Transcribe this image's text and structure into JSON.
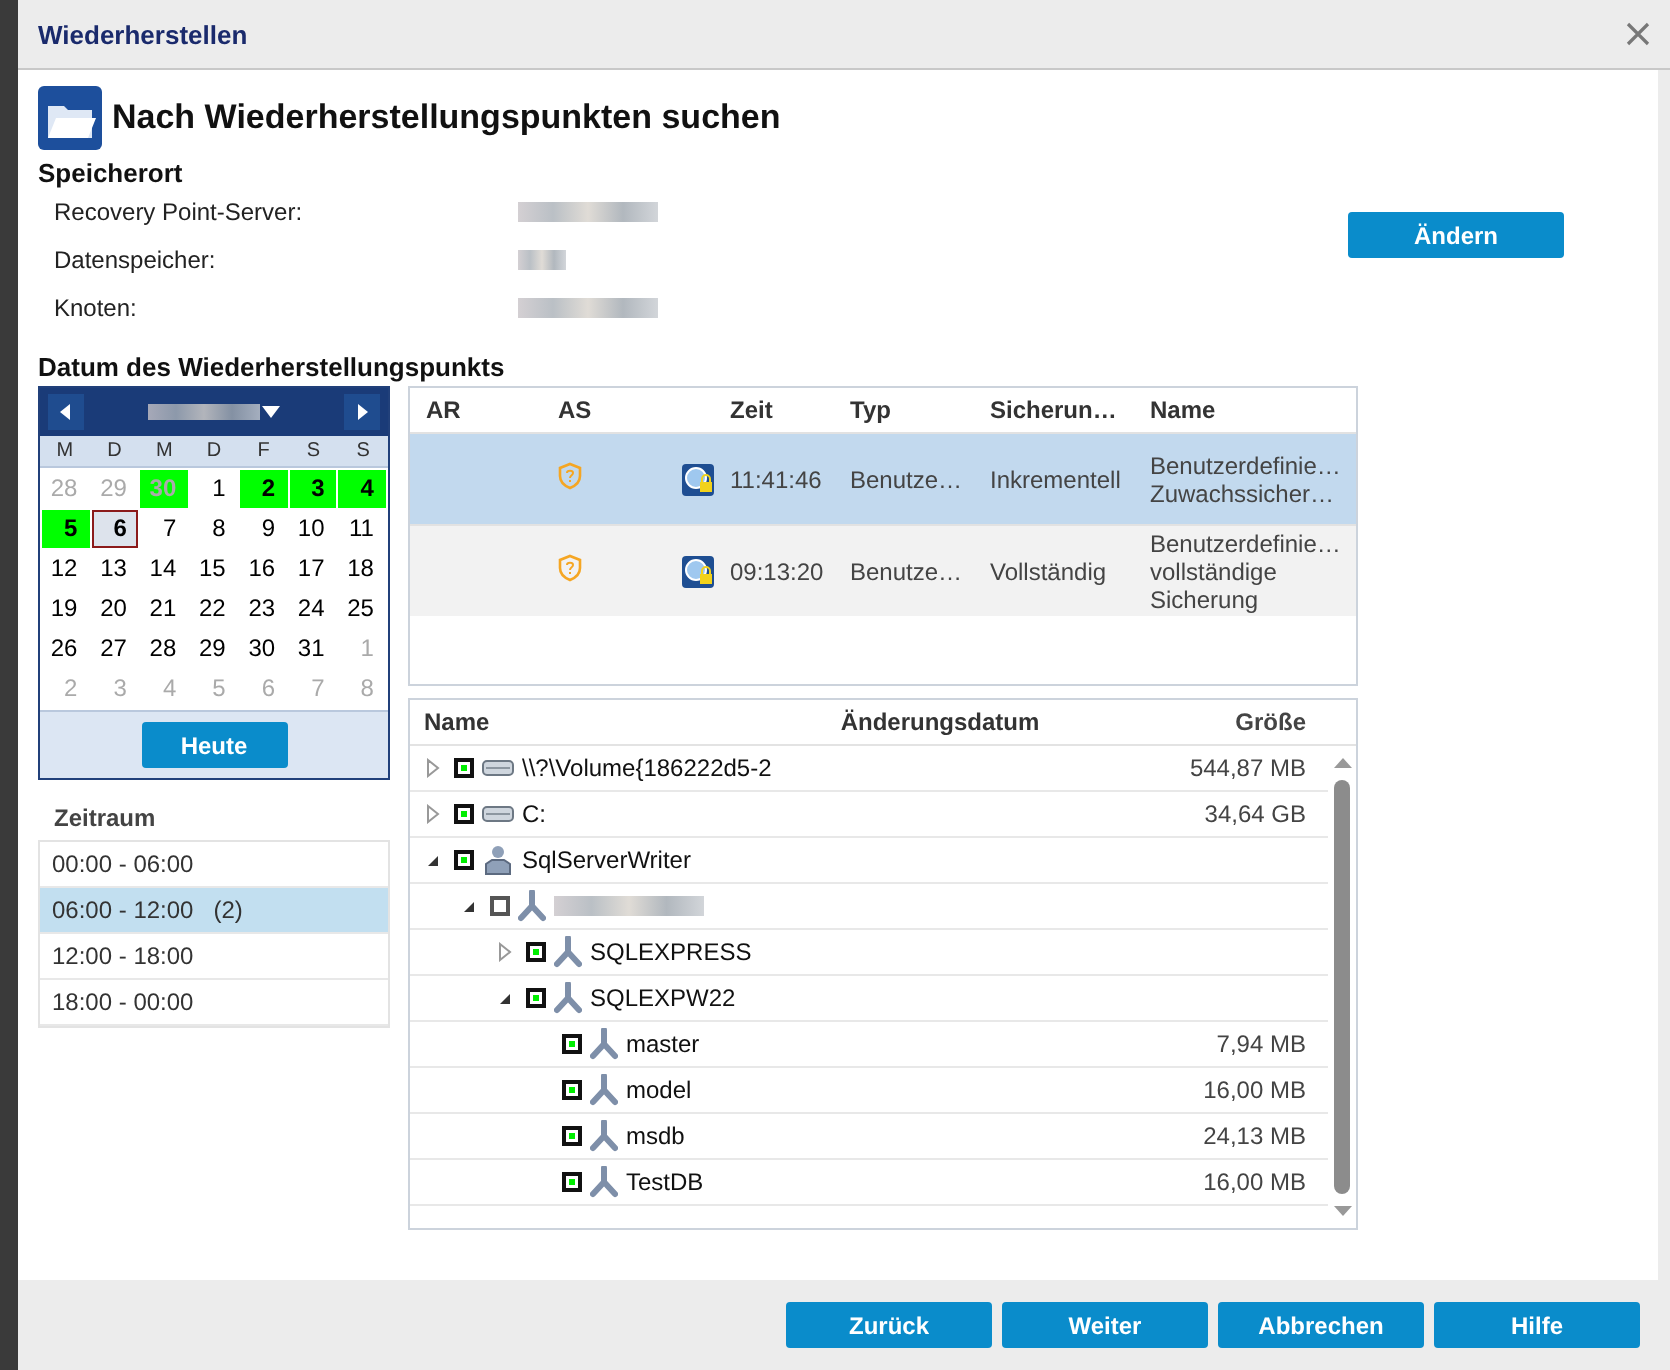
{
  "window": {
    "title": "Wiederherstellen"
  },
  "heading": "Nach Wiederherstellungspunkten suchen",
  "location": {
    "title": "Speicherort",
    "change_button": "Ändern",
    "fields": [
      {
        "label": "Recovery Point-Server:"
      },
      {
        "label": "Datenspeicher:"
      },
      {
        "label": "Knoten:"
      }
    ]
  },
  "date_section": {
    "title": "Datum des Wiederherstellungspunkts",
    "calendar": {
      "weekdays": [
        "M",
        "D",
        "M",
        "D",
        "F",
        "S",
        "S"
      ],
      "today_button": "Heute",
      "days": [
        {
          "label": "28",
          "other_month": true,
          "has_backup": false,
          "selected": false
        },
        {
          "label": "29",
          "other_month": true,
          "has_backup": false,
          "selected": false
        },
        {
          "label": "30",
          "other_month": true,
          "has_backup": true,
          "selected": false
        },
        {
          "label": "1",
          "other_month": false,
          "has_backup": false,
          "selected": false
        },
        {
          "label": "2",
          "other_month": false,
          "has_backup": true,
          "selected": false
        },
        {
          "label": "3",
          "other_month": false,
          "has_backup": true,
          "selected": false
        },
        {
          "label": "4",
          "other_month": false,
          "has_backup": true,
          "selected": false
        },
        {
          "label": "5",
          "other_month": false,
          "has_backup": true,
          "selected": false
        },
        {
          "label": "6",
          "other_month": false,
          "has_backup": false,
          "selected": true
        },
        {
          "label": "7",
          "other_month": false,
          "has_backup": false,
          "selected": false
        },
        {
          "label": "8",
          "other_month": false,
          "has_backup": false,
          "selected": false
        },
        {
          "label": "9",
          "other_month": false,
          "has_backup": false,
          "selected": false
        },
        {
          "label": "10",
          "other_month": false,
          "has_backup": false,
          "selected": false
        },
        {
          "label": "11",
          "other_month": false,
          "has_backup": false,
          "selected": false
        },
        {
          "label": "12",
          "other_month": false,
          "has_backup": false,
          "selected": false
        },
        {
          "label": "13",
          "other_month": false,
          "has_backup": false,
          "selected": false
        },
        {
          "label": "14",
          "other_month": false,
          "has_backup": false,
          "selected": false
        },
        {
          "label": "15",
          "other_month": false,
          "has_backup": false,
          "selected": false
        },
        {
          "label": "16",
          "other_month": false,
          "has_backup": false,
          "selected": false
        },
        {
          "label": "17",
          "other_month": false,
          "has_backup": false,
          "selected": false
        },
        {
          "label": "18",
          "other_month": false,
          "has_backup": false,
          "selected": false
        },
        {
          "label": "19",
          "other_month": false,
          "has_backup": false,
          "selected": false
        },
        {
          "label": "20",
          "other_month": false,
          "has_backup": false,
          "selected": false
        },
        {
          "label": "21",
          "other_month": false,
          "has_backup": false,
          "selected": false
        },
        {
          "label": "22",
          "other_month": false,
          "has_backup": false,
          "selected": false
        },
        {
          "label": "23",
          "other_month": false,
          "has_backup": false,
          "selected": false
        },
        {
          "label": "24",
          "other_month": false,
          "has_backup": false,
          "selected": false
        },
        {
          "label": "25",
          "other_month": false,
          "has_backup": false,
          "selected": false
        },
        {
          "label": "26",
          "other_month": false,
          "has_backup": false,
          "selected": false
        },
        {
          "label": "27",
          "other_month": false,
          "has_backup": false,
          "selected": false
        },
        {
          "label": "28",
          "other_month": false,
          "has_backup": false,
          "selected": false
        },
        {
          "label": "29",
          "other_month": false,
          "has_backup": false,
          "selected": false
        },
        {
          "label": "30",
          "other_month": false,
          "has_backup": false,
          "selected": false
        },
        {
          "label": "31",
          "other_month": false,
          "has_backup": false,
          "selected": false
        },
        {
          "label": "1",
          "other_month": true,
          "has_backup": false,
          "selected": false
        },
        {
          "label": "2",
          "other_month": true,
          "has_backup": false,
          "selected": false
        },
        {
          "label": "3",
          "other_month": true,
          "has_backup": false,
          "selected": false
        },
        {
          "label": "4",
          "other_month": true,
          "has_backup": false,
          "selected": false
        },
        {
          "label": "5",
          "other_month": true,
          "has_backup": false,
          "selected": false
        },
        {
          "label": "6",
          "other_month": true,
          "has_backup": false,
          "selected": false
        },
        {
          "label": "7",
          "other_month": true,
          "has_backup": false,
          "selected": false
        },
        {
          "label": "8",
          "other_month": true,
          "has_backup": false,
          "selected": false
        }
      ]
    },
    "time_range": {
      "title": "Zeitraum",
      "items": [
        {
          "label": "00:00 - 06:00",
          "selected": false
        },
        {
          "label": "06:00 - 12:00",
          "count": "(2)",
          "selected": true
        },
        {
          "label": "12:00 - 18:00",
          "selected": false
        },
        {
          "label": "18:00 - 00:00",
          "selected": false
        }
      ]
    }
  },
  "recovery_points": {
    "columns": [
      "AR",
      "AS",
      "Zeit",
      "Typ",
      "Sicherun…",
      "Name"
    ],
    "rows": [
      {
        "selected": true,
        "time": "11:41:46",
        "type": "Benutze…",
        "backup_type": "Inkrementell",
        "name_lines": [
          "Benutzerdefinie…",
          "Zuwachssicher…"
        ]
      },
      {
        "selected": false,
        "time": "09:13:20",
        "type": "Benutze…",
        "backup_type": "Vollständig",
        "name_lines": [
          "Benutzerdefinie…",
          "vollständige",
          "Sicherung"
        ]
      }
    ]
  },
  "files": {
    "columns": [
      "Name",
      "Änderungsdatum",
      "Größe"
    ],
    "tree": [
      {
        "kind": "drive",
        "name": "\\\\?\\Volume{186222d5-2",
        "size": "544,87 MB",
        "checked": true,
        "expanded": false
      },
      {
        "kind": "drive",
        "name": "C:",
        "size": "34,64 GB",
        "checked": true,
        "expanded": false
      },
      {
        "kind": "writer",
        "name": "SqlServerWriter",
        "checked": true,
        "expanded": true,
        "children": [
          {
            "kind": "component",
            "checked": false,
            "expanded": true,
            "children": [
              {
                "kind": "component",
                "name": "SQLEXPRESS",
                "checked": true,
                "expanded": false
              },
              {
                "kind": "component",
                "name": "SQLEXPW22",
                "checked": true,
                "expanded": true,
                "children": [
                  {
                    "kind": "component",
                    "name": "master",
                    "size": "7,94 MB",
                    "checked": true
                  },
                  {
                    "kind": "component",
                    "name": "model",
                    "size": "16,00 MB",
                    "checked": true
                  },
                  {
                    "kind": "component",
                    "name": "msdb",
                    "size": "24,13 MB",
                    "checked": true
                  },
                  {
                    "kind": "component",
                    "name": "TestDB",
                    "size": "16,00 MB",
                    "checked": true
                  }
                ]
              }
            ]
          }
        ]
      }
    ]
  },
  "buttons": [
    "Zurück",
    "Weiter",
    "Abbrechen",
    "Hilfe"
  ]
}
